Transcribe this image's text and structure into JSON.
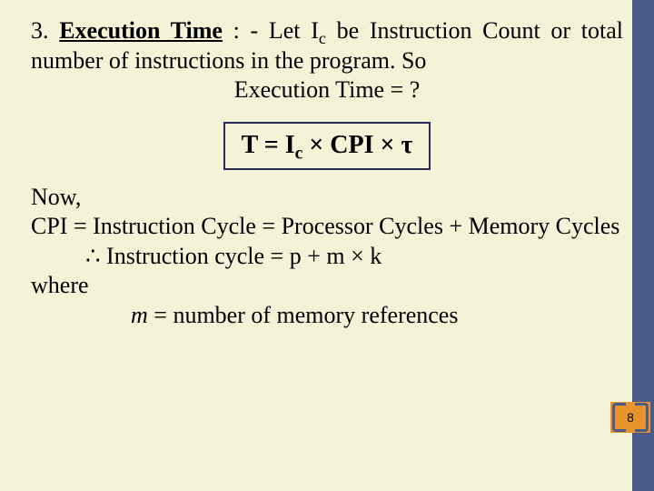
{
  "title_num": "3.",
  "title_text": "Execution Time",
  "title_sep": " : -  ",
  "intro_a": "Let I",
  "intro_sub": "c",
  "intro_b": " be Instruction Count or total number of instructions in the program. So",
  "exec_time_q": "Execution Time = ?",
  "formula": {
    "a": "T = I",
    "sub": "c",
    "b": " × CPI × ",
    "tau": "τ"
  },
  "now": "Now,",
  "cpi_line": " CPI = Instruction Cycle = Processor Cycles + Memory Cycles",
  "therefore": "∴",
  "inst_cycle": "  Instruction cycle = p + m × k",
  "where": "where",
  "m_def_a": "m",
  "m_def_b": " = number of memory references",
  "page": "8"
}
